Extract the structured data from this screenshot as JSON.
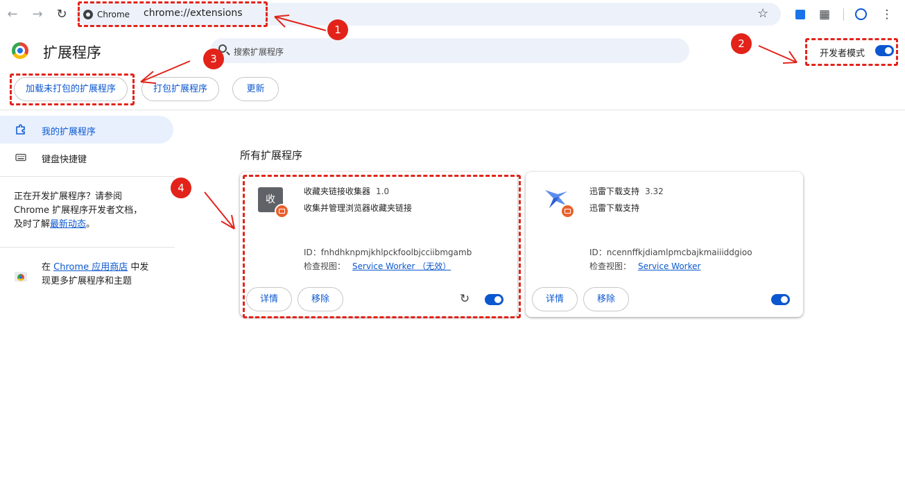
{
  "browser": {
    "chip_label": "Chrome",
    "url": "chrome://extensions"
  },
  "header": {
    "title": "扩展程序",
    "search_placeholder": "搜索扩展程序",
    "dev_mode_label": "开发者模式",
    "dev_mode_on": true
  },
  "actions": {
    "load_unpacked": "加载未打包的扩展程序",
    "pack": "打包扩展程序",
    "update": "更新"
  },
  "sidebar": {
    "items": [
      {
        "label": "我的扩展程序",
        "active": true
      },
      {
        "label": "键盘快捷键",
        "active": false
      }
    ],
    "dev_text_1": "正在开发扩展程序？请参阅",
    "dev_text_2": "Chrome 扩展程序开发者文档，",
    "dev_text_3": "及时了解",
    "dev_link": "最新动态",
    "dev_text_end": "。",
    "store_prefix": "在 ",
    "store_link": "Chrome 应用商店",
    "store_suffix": " 中发",
    "store_line2": "现更多扩展程序和主题"
  },
  "main": {
    "section_title": "所有扩展程序",
    "extensions": [
      {
        "icon_text": "收",
        "name": "收藏夹链接收集器",
        "version": "1.0",
        "description": "收集并管理浏览器收藏夹链接",
        "id_label": "ID：",
        "id": "fnhdhknpmjkhlpckfoolbjcciibmgamb",
        "view_label": "检查视图：",
        "view_link": "Service Worker （无效）",
        "details_label": "详情",
        "remove_label": "移除",
        "enabled": true
      },
      {
        "name": "迅雷下载支持",
        "version": "3.32",
        "description": "迅雷下载支持",
        "id_label": "ID：",
        "id": "ncennffkjdiamlpmcbajkmaiiiddgioo",
        "view_label": "检查视图：",
        "view_link": "Service Worker",
        "details_label": "详情",
        "remove_label": "移除",
        "enabled": true
      }
    ]
  },
  "annotations": {
    "badges": [
      "1",
      "2",
      "3",
      "4"
    ],
    "color": "#e2231a"
  },
  "colors": {
    "accent": "#0b57d0",
    "omnibox_bg": "#edf2fa"
  }
}
